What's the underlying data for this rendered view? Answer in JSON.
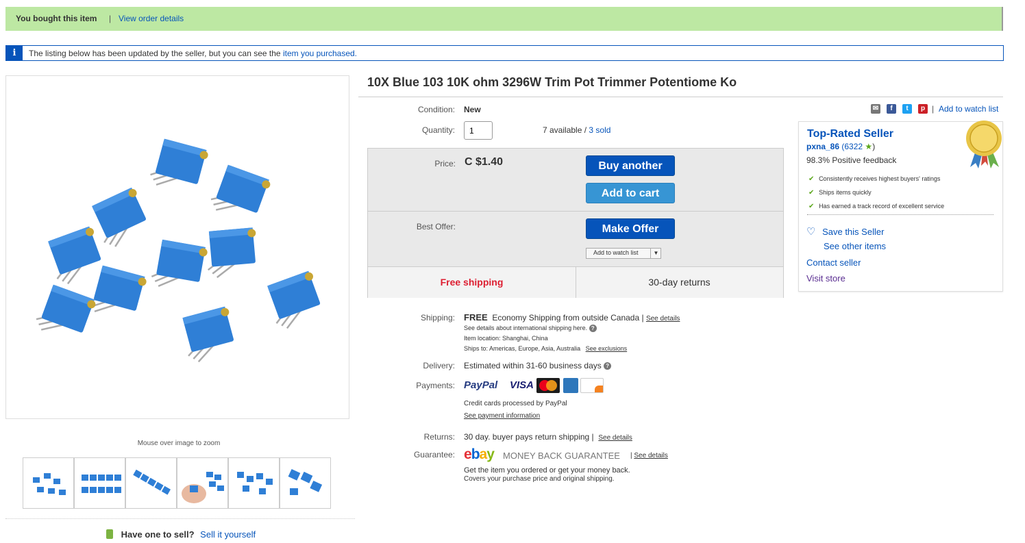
{
  "banner": {
    "bought_text": "You bought this item",
    "separator": "|",
    "order_link": "View order details",
    "updated_icon": "i",
    "updated_text": "The listing below has been updated by the seller, but you can see the",
    "updated_link": "item you purchased."
  },
  "item": {
    "title": "10X Blue 103 10K ohm 3296W Trim Pot Trimmer Potentiome Ko",
    "zoom_hint": "Mouse over image to zoom",
    "condition_label": "Condition:",
    "condition_value": "New",
    "quantity_label": "Quantity:",
    "quantity_value": "1",
    "available_text": "7 available /",
    "sold_link": "3 sold"
  },
  "pricebox": {
    "price_label": "Price:",
    "price_value": "C $1.40",
    "buy_another": "Buy another",
    "add_to_cart": "Add to cart",
    "best_offer_label": "Best Offer:",
    "make_offer": "Make Offer",
    "add_watch_small": "Add to watch list",
    "free_shipping": "Free shipping",
    "returns": "30-day returns"
  },
  "details": {
    "shipping_label": "Shipping:",
    "shipping_free": "FREE",
    "shipping_text": "Economy Shipping from outside Canada |",
    "see_details": "See details",
    "intl_text": "See details about international shipping here.",
    "location_text": "Item location:  Shanghai, China",
    "ships_to": "Ships to:   Americas, Europe, Asia, Australia",
    "see_exclusions": "See exclusions",
    "delivery_label": "Delivery:",
    "delivery_text": "Estimated within 31-60 business days",
    "payments_label": "Payments:",
    "paypal": "PayPal",
    "visa": "VISA",
    "credit_text": "Credit cards processed by PayPal",
    "payment_info": "See payment information",
    "returns_label": "Returns:",
    "returns_text": "30 day. buyer pays return shipping |",
    "returns_details": "See details",
    "guarantee_label": "Guarantee:",
    "guarantee_text": "MONEY BACK GUARANTEE",
    "guarantee_details": "See details",
    "guarantee_line1": "Get the item you ordered or get your money back.",
    "guarantee_line2": "Covers your purchase price and original shipping."
  },
  "seller": {
    "top_rated": "Top-Rated Seller",
    "name": "pxna_86",
    "score": "(6322",
    "score_end": ")",
    "feedback": "98.3% Positive feedback",
    "features": [
      "Consistently receives highest buyers' ratings",
      "Ships items quickly",
      "Has earned a track record of excellent service"
    ],
    "save_seller": "Save this Seller",
    "other_items": "See other items",
    "contact": "Contact seller",
    "store": "Visit store"
  },
  "watch": {
    "separator": "|",
    "add_link": "Add to watch list"
  },
  "sell": {
    "question": "Have one to sell?",
    "link": "Sell it yourself"
  },
  "colors": {
    "link": "#0654ba",
    "banner_green": "#bde8a3",
    "free_shipping": "#dd1e31"
  }
}
